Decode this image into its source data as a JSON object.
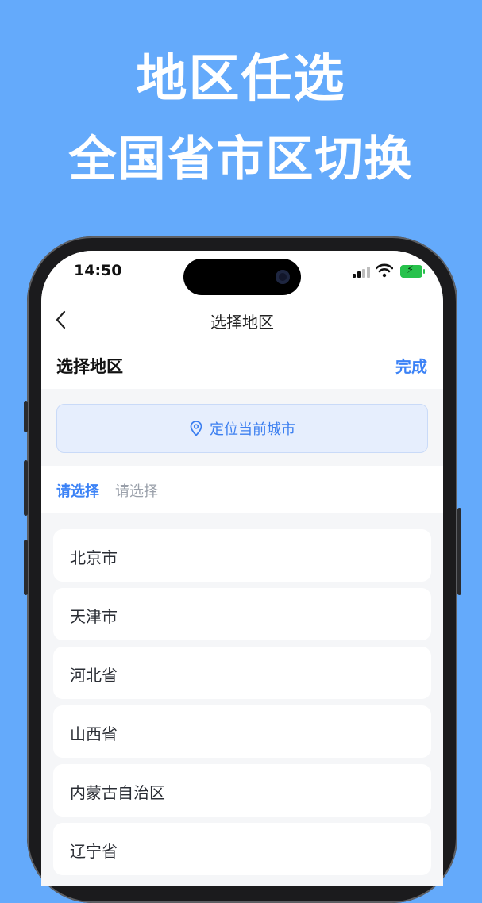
{
  "promo": {
    "line1": "地区任选",
    "line2": "全国省市区切换"
  },
  "status_bar": {
    "time": "14:50",
    "battery_color": "#27c24c"
  },
  "nav": {
    "title": "选择地区",
    "back_icon": "chevron-left-icon"
  },
  "header": {
    "title": "选择地区",
    "done_label": "完成"
  },
  "locate": {
    "label": "定位当前城市",
    "icon": "location-pin-icon"
  },
  "tabs": [
    {
      "label": "请选择",
      "active": true
    },
    {
      "label": "请选择",
      "active": false
    }
  ],
  "regions": [
    "北京市",
    "天津市",
    "河北省",
    "山西省",
    "内蒙古自治区",
    "辽宁省"
  ],
  "colors": {
    "background": "#64aafb",
    "accent": "#3b82f6"
  }
}
